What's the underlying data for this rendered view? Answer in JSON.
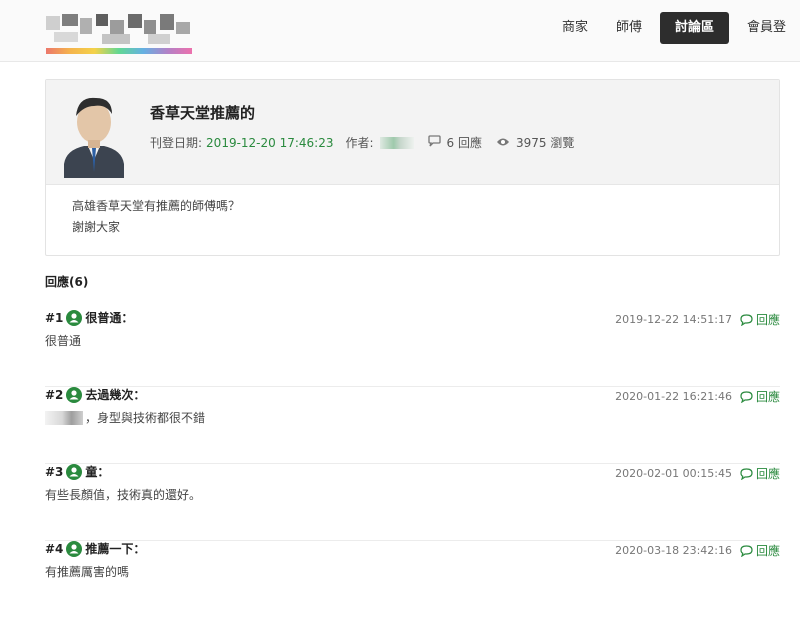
{
  "nav": {
    "items": [
      "商家",
      "師傅",
      "討論區",
      "會員登"
    ],
    "active_index": 2
  },
  "post": {
    "title": "香草天堂推薦的",
    "date_label": "刊登日期:",
    "date": "2019-12-20 17:46:23",
    "author_label": "作者:",
    "replies": "6 回應",
    "views": "3975 瀏覽",
    "body": [
      "高雄香草天堂有推薦的師傅嗎？",
      "謝謝大家"
    ]
  },
  "replies_title": "回應(6)",
  "replies": [
    {
      "num": "#1",
      "user": "很普通：",
      "time": "2019-12-22 14:51:17",
      "action": "回應",
      "text": "很普通",
      "masked_prefix": false
    },
    {
      "num": "#2",
      "user": "去過幾次：",
      "time": "2020-01-22 16:21:46",
      "action": "回應",
      "text": "，身型與技術都很不錯",
      "masked_prefix": true
    },
    {
      "num": "#3",
      "user": "童：",
      "time": "2020-02-01 00:15:45",
      "action": "回應",
      "text": "有些長顏值，技術真的還好。",
      "masked_prefix": false
    },
    {
      "num": "#4",
      "user": "推薦一下：",
      "time": "2020-03-18 23:42:16",
      "action": "回應",
      "text": "有推薦厲害的嗎",
      "masked_prefix": false
    }
  ],
  "colors": {
    "accent_green": "#2a8a3e",
    "nav_active_bg": "#2d2d2d"
  }
}
